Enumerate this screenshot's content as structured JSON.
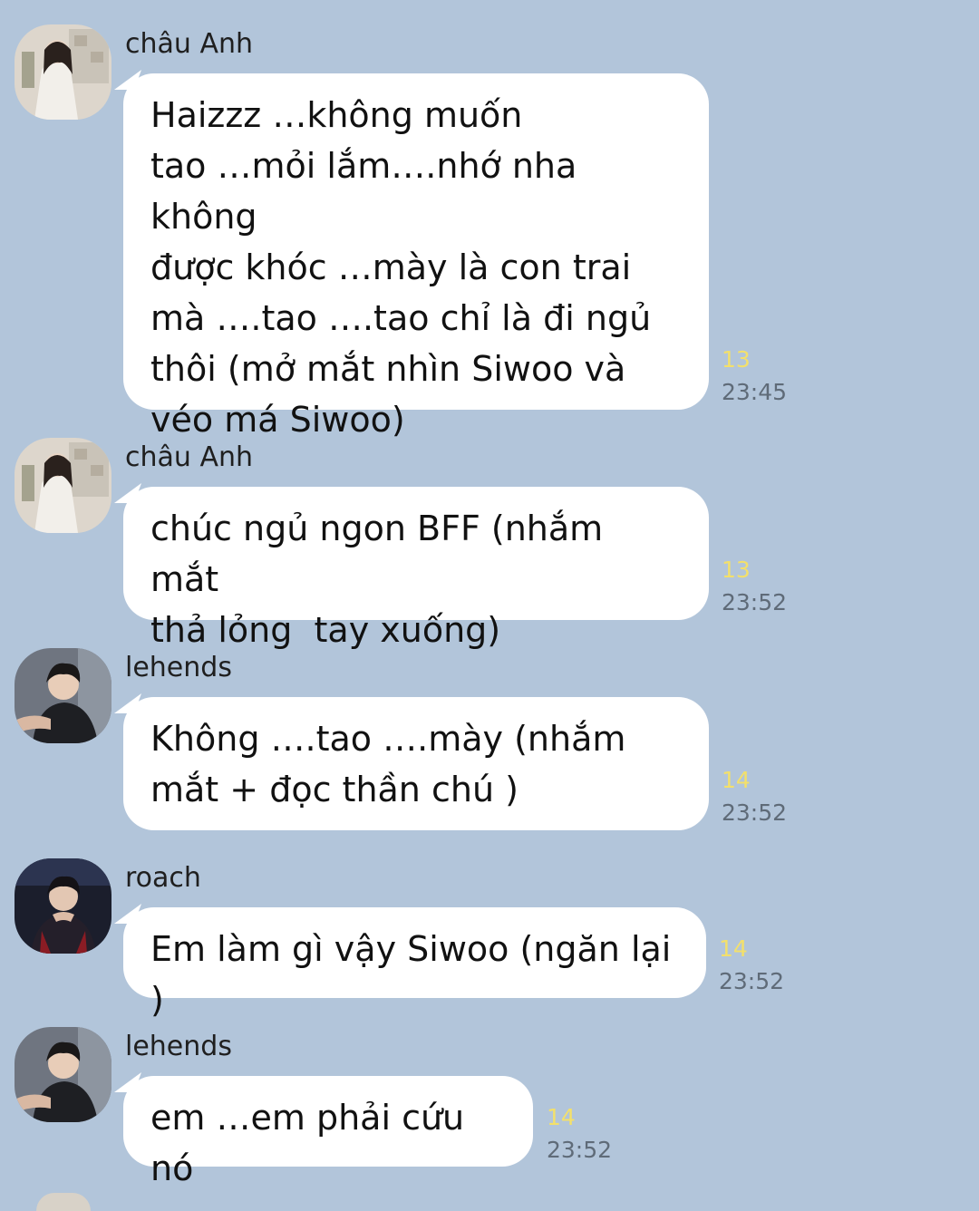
{
  "messages": [
    {
      "sender": "châu Anh",
      "avatar": "girl-in-white-dress-photo",
      "text": "Haizzz …không muốn\ntao …mỏi lắm….nhớ nha không\nđược khóc …mày là con trai\nmà ….tao ….tao chỉ là đi ngủ\nthôi (mở mắt nhìn Siwoo và\nvéo má Siwoo)",
      "read_count": "13",
      "time": "23:45"
    },
    {
      "sender": "châu Anh",
      "avatar": "girl-in-white-dress-photo",
      "text": "chúc ngủ ngon BFF (nhắm mắt\nthả lỏng  tay xuống)",
      "read_count": "13",
      "time": "23:52"
    },
    {
      "sender": "lehends",
      "avatar": "boy-in-black-jersey-photo",
      "text": "Không ….tao ….mày (nhắm\nmắt + đọc thần chú )",
      "read_count": "14",
      "time": "23:52"
    },
    {
      "sender": "roach",
      "avatar": "boy-on-stage-photo",
      "text": "Em làm gì vậy Siwoo (ngăn lại )",
      "read_count": "14",
      "time": "23:52"
    },
    {
      "sender": "lehends",
      "avatar": "boy-in-black-jersey-photo",
      "text": "em …em phải cứu nó",
      "read_count": "14",
      "time": "23:52"
    }
  ],
  "colors": {
    "background": "#b2c5da",
    "bubble": "#ffffff",
    "read_count": "#f3e06b",
    "timestamp": "#5f6b78"
  }
}
